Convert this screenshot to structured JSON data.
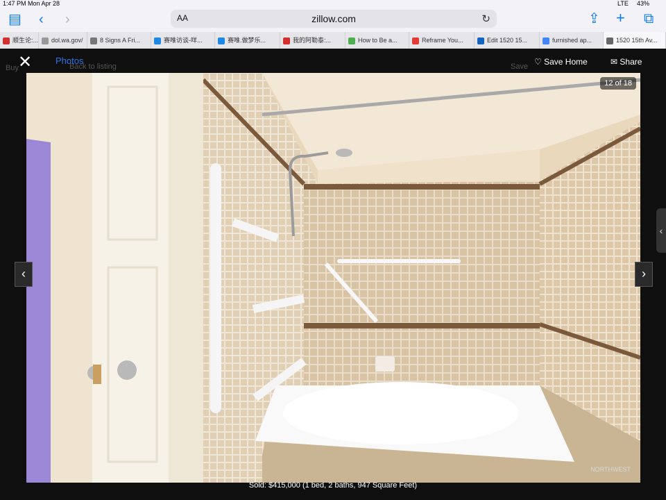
{
  "status": {
    "time": "1:47 PM",
    "date": "Mon Apr 28",
    "network": "LTE",
    "battery": "43%"
  },
  "browser": {
    "domain": "zillow.com",
    "text_size_label": "AA",
    "tabs": [
      {
        "label": "顺生论:...",
        "color": "#d32f2f"
      },
      {
        "label": "dol.wa.gov/",
        "color": "#999999"
      },
      {
        "label": "8 Signs A Fri...",
        "color": "#777777"
      },
      {
        "label": "赛唯访谈-咩...",
        "color": "#1e88e5"
      },
      {
        "label": "赛唯.做梦乐...",
        "color": "#1e88e5"
      },
      {
        "label": "我的阿勒泰:...",
        "color": "#d32f2f"
      },
      {
        "label": "How to Be a...",
        "color": "#4caf50"
      },
      {
        "label": "Reframe You...",
        "color": "#e53935"
      },
      {
        "label": "Edit 1520 15...",
        "color": "#1565c0"
      },
      {
        "label": "furnished ap...",
        "color": "#4285f4"
      },
      {
        "label": "1520 15th Av...",
        "color": "#666666"
      }
    ]
  },
  "viewer": {
    "photos_tab": "Photos",
    "save_home": "Save Home",
    "share": "Share",
    "counter": "12 of 18",
    "caption": "Sold: $415,000 (1 bed, 2 baths, 947 Square Feet)",
    "watermark": "NORTHWEST"
  },
  "background_page": {
    "left_text": "Buy",
    "listing_text": "Back to listing",
    "save_text": "Save"
  },
  "colors": {
    "accent": "#2d74e8",
    "ios_blue": "#0a7aff"
  }
}
